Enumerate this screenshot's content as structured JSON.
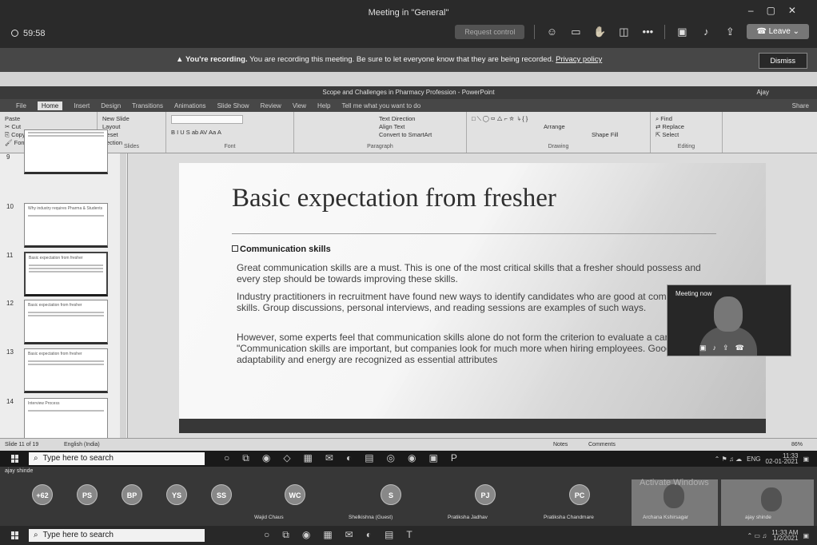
{
  "teams": {
    "title": "Meeting in \"General\"",
    "timer": "59:58",
    "join_text": "Request control",
    "leave_label": "Leave",
    "recording_bold": "You're recording.",
    "recording_text": "You are recording this meeting. Be sure to let everyone know that they are being recorded.",
    "privacy_link": "Privacy policy",
    "dismiss_label": "Dismiss"
  },
  "ppt": {
    "window_title": "Scope and Challenges in Pharmacy Profession - PowerPoint",
    "user_name": "Ajay",
    "menu": [
      "File",
      "Home",
      "Insert",
      "Design",
      "Transitions",
      "Animations",
      "Slide Show",
      "Review",
      "View",
      "Help",
      "Tell me what you want to do"
    ],
    "share_label": "Share",
    "ribbon": {
      "clipboard": {
        "paste": "Paste",
        "cut": "Cut",
        "copy": "Copy",
        "format_painter": "Format Painter",
        "label": "Clipboard"
      },
      "slides": {
        "new_slide": "New Slide",
        "layout": "Layout",
        "reset": "Reset",
        "section": "Section",
        "label": "Slides"
      },
      "font": {
        "label": "Font"
      },
      "paragraph": {
        "text_direction": "Text Direction",
        "align_text": "Align Text",
        "convert_smartart": "Convert to SmartArt",
        "label": "Paragraph"
      },
      "drawing": {
        "arrange": "Arrange",
        "quick_styles": "Quick Styles",
        "shape_fill": "Shape Fill",
        "shape_outline": "Shape Outline",
        "shape_effects": "Shape Effects",
        "label": "Drawing"
      },
      "editing": {
        "find": "Find",
        "replace": "Replace",
        "select": "Select",
        "label": "Editing"
      }
    },
    "thumb_numbers": [
      "9",
      "10",
      "11",
      "12",
      "13",
      "14"
    ],
    "thumb_titles": [
      "",
      "Why industry requires Pharma & Students",
      "Basic expectation from fresher",
      "Basic expectation from fresher",
      "Basic expectation from fresher",
      "Interview Process"
    ],
    "slide": {
      "title": "Basic expectation from fresher",
      "subheading": "Communication skills",
      "paragraphs": [
        "Great communication skills are a must. This is one of the most critical skills that a fresher should possess and every step should be towards improving these skills.",
        "Industry practitioners in recruitment have found new ways to identify candidates who are good at communication skills. Group discussions, personal interviews, and reading sessions are examples of such ways.",
        "However, some experts feel that communication skills alone do not form the criterion to evaluate a candidate. \"Communication skills are important, but companies look for much more when hiring employees. Good attitude, adaptability and energy are recognized as essential attributes"
      ]
    },
    "video_label": "Meeting now",
    "status_slide": "Slide 11 of 19",
    "status_lang": "English (India)",
    "status_notes": "Notes",
    "status_comments": "Comments",
    "status_zoom": "86%"
  },
  "inner_taskbar": {
    "search_placeholder": "Type here to search",
    "lang": "ENG",
    "time": "11:33",
    "date": "02-01-2021"
  },
  "participants": {
    "top_name": "ajay shinde",
    "avatars": [
      {
        "initials": "+62",
        "label": ""
      },
      {
        "initials": "PS",
        "label": ""
      },
      {
        "initials": "BP",
        "label": ""
      },
      {
        "initials": "YS",
        "label": ""
      },
      {
        "initials": "SS",
        "label": ""
      },
      {
        "initials": "WC",
        "label": "Wajid Chaus"
      },
      {
        "initials": "S",
        "label": "Shelkishna (Guest)"
      },
      {
        "initials": "PJ",
        "label": "Pratiksha Jadhav"
      },
      {
        "initials": "PC",
        "label": "Pratiksha Chandmare"
      }
    ],
    "cam1_label": "Archana Kshirsagar",
    "cam2_label": "ajay shinde",
    "watermark": "Activate Windows"
  },
  "outer_taskbar": {
    "search_placeholder": "Type here to search",
    "time": "11:33 AM",
    "date": "1/2/2021"
  }
}
